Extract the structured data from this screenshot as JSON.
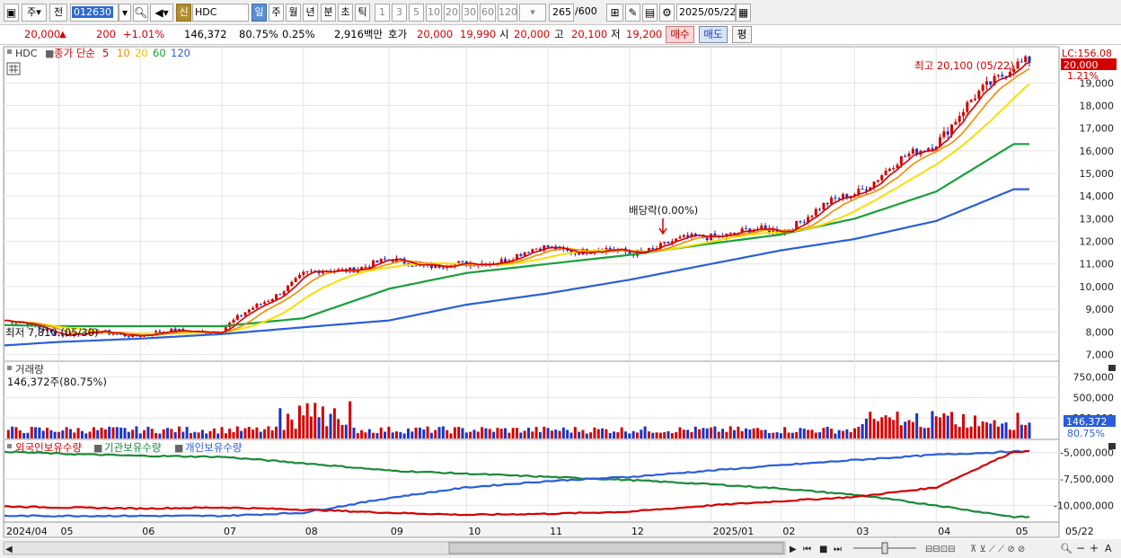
{
  "toolbar": {
    "market_label": "주",
    "prev_label": "전",
    "code": "012630",
    "badge_label": "신",
    "stock_name": "HDC",
    "period_tabs": [
      "일",
      "주",
      "월",
      "년",
      "분",
      "초",
      "틱"
    ],
    "period_active": "일",
    "numbers": [
      "1",
      "3",
      "5",
      "10",
      "20",
      "30",
      "60",
      "120"
    ],
    "count": "265",
    "count_total": "/600",
    "date": "2025/05/22"
  },
  "quote": {
    "price": "20,000",
    "change": "200",
    "change_pct": "+1.01%",
    "volume": "146,372",
    "volume_ratio": "80.75%",
    "turnover_ratio": "0.25%",
    "amount": "2,916백만",
    "bid_label": "호가",
    "ask_price": "20,000",
    "bid_price": "19,990",
    "open_label": "시",
    "open_value": "20,000",
    "high_label": "고",
    "high_value": "20,100",
    "low_label": "저",
    "low_value": "19,200",
    "buy_button": "매수",
    "sell_button": "매도",
    "eval_button": "평"
  },
  "price_panel": {
    "symbol": "HDC",
    "ma_title": "종가 단순",
    "ma_labels": [
      "5",
      "10",
      "20",
      "60",
      "120"
    ],
    "ma_colors": [
      "#d40000",
      "#f08c00",
      "#f5e000",
      "#1aa03a",
      "#2a5fd8"
    ],
    "high_note": "최고 20,100 (05/22)",
    "low_note": "최저 7,810 (05/30)",
    "dividend_note": "배당락(0.00%)",
    "lc_label": "LC:156.08",
    "price_tag": "20,000",
    "pct_tag": "1.21%",
    "y_labels": [
      "19,000",
      "18,000",
      "17,000",
      "16,000",
      "15,000",
      "14,000",
      "13,000",
      "12,000",
      "11,000",
      "10,000",
      "9,000",
      "8,000",
      "7,000"
    ]
  },
  "volume_panel": {
    "title": "거래량",
    "subtitle": "146,372주(80.75%)",
    "y_labels": [
      "750,000",
      "500,000",
      "250,000"
    ],
    "last_tag": "146,372",
    "pct_tag": "80.75%"
  },
  "holders_panel": {
    "legend": [
      "외국인보유수량",
      "기관보유수량",
      "개인보유수량"
    ],
    "legend_colors": [
      "#d40000",
      "#1a8a3a",
      "#2a5fd8"
    ],
    "y_labels": [
      "-5,000,000",
      "-7,500,000",
      "-10,000,000"
    ]
  },
  "x_axis": {
    "labels": [
      "2024/04",
      "05",
      "06",
      "07",
      "08",
      "09",
      "10",
      "11",
      "12",
      "2025/01",
      "02",
      "03",
      "04",
      "05"
    ],
    "right_label": "05/22"
  },
  "chart_data": {
    "type": "line",
    "title": "HDC",
    "x": [
      "2024/04",
      "05",
      "06",
      "07",
      "08",
      "09",
      "10",
      "11",
      "12",
      "2025/01",
      "02",
      "03",
      "04",
      "05"
    ],
    "series": [
      {
        "name": "종가",
        "values": [
          8500,
          7950,
          7900,
          8100,
          10500,
          11100,
          10900,
          11700,
          11500,
          12300,
          12500,
          14200,
          16500,
          20000
        ]
      },
      {
        "name": "60",
        "values": [
          8300,
          8250,
          8250,
          8250,
          8600,
          9900,
          10600,
          11000,
          11400,
          11900,
          12300,
          13000,
          14200,
          16300
        ]
      },
      {
        "name": "120",
        "values": [
          7400,
          7550,
          7700,
          7900,
          8200,
          8500,
          9200,
          9700,
          10300,
          11000,
          11600,
          12100,
          12900,
          14300
        ]
      }
    ],
    "ylim": [
      6700,
      20600
    ],
    "xlabel": "",
    "ylabel": ""
  }
}
